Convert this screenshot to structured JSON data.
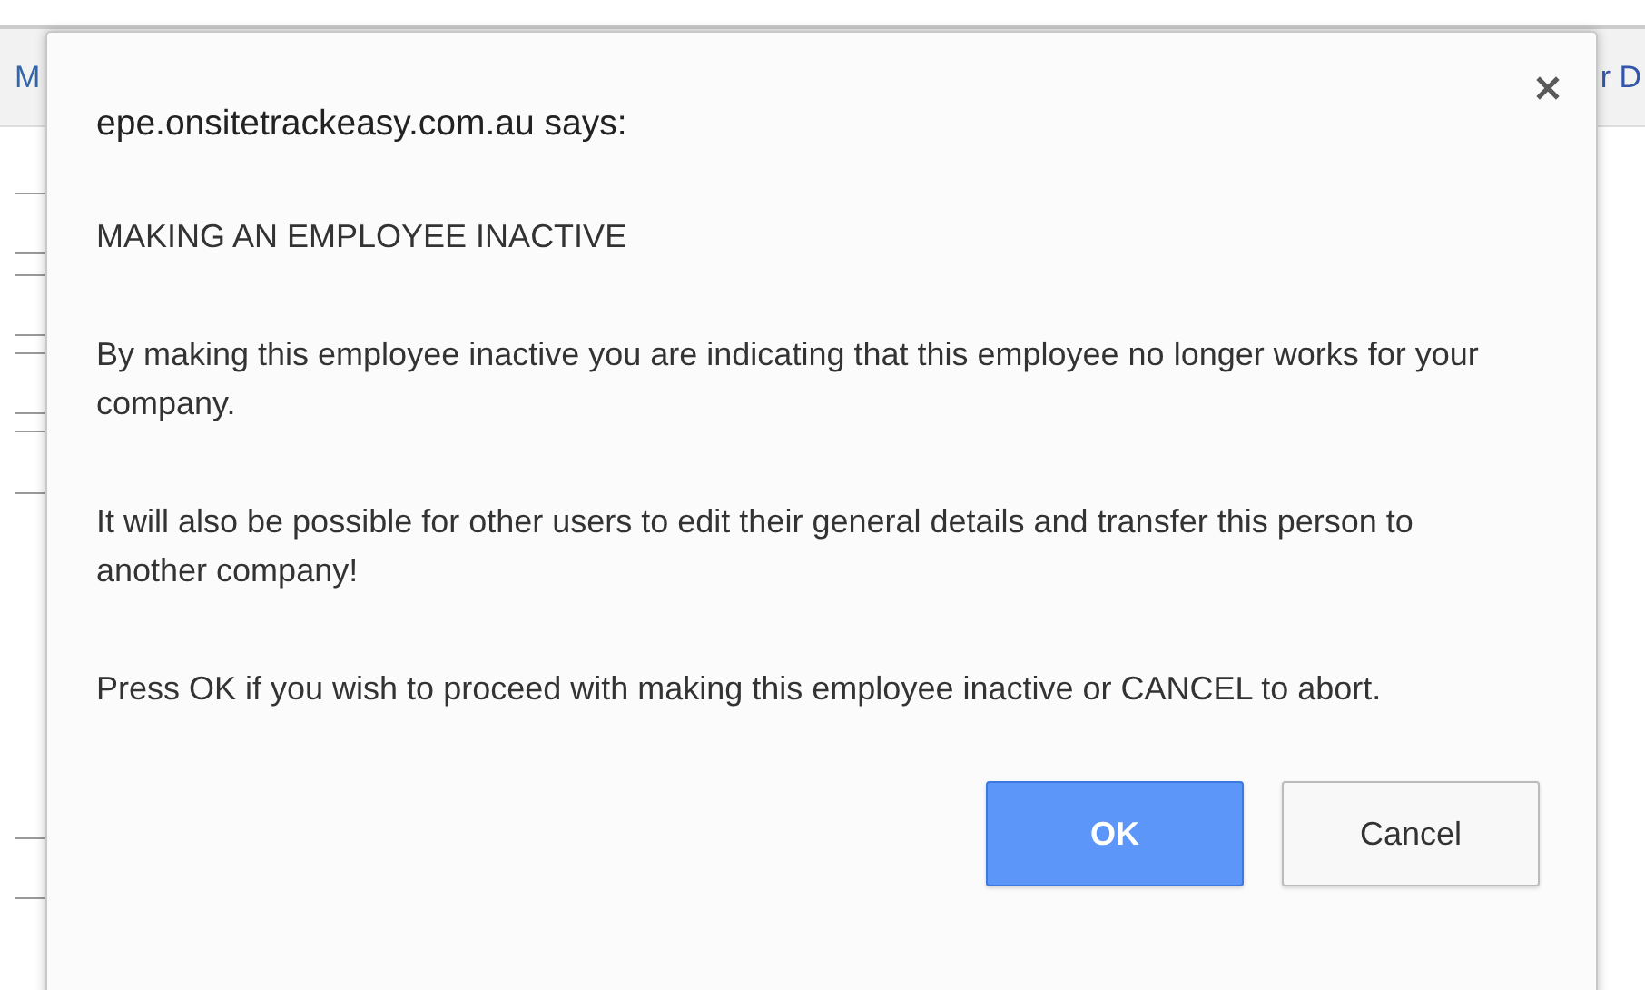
{
  "page": {
    "header_left": "M",
    "header_right": "r D"
  },
  "dialog": {
    "title": "epe.onsitetrackeasy.com.au says:",
    "paragraphs": [
      "MAKING AN EMPLOYEE INACTIVE",
      "By making this employee inactive you are indicating that this employee no longer works for your company.",
      "It will also be possible for other users to edit their general details and transfer this person to another company!",
      "Press OK if you wish to proceed with making this employee inactive or CANCEL to abort."
    ],
    "buttons": [
      {
        "label": "OK",
        "kind": "primary"
      },
      {
        "label": "Cancel",
        "kind": "secondary"
      }
    ]
  }
}
